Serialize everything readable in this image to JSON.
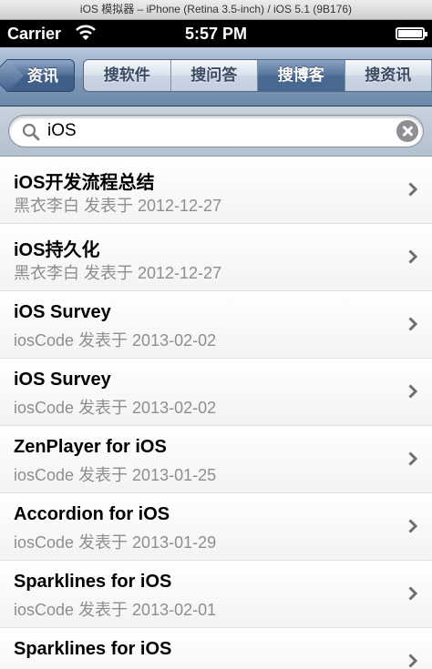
{
  "window_title": "iOS 模拟器 – iPhone (Retina 3.5-inch) / iOS 5.1 (9B176)",
  "status_bar": {
    "carrier": "Carrier",
    "time": "5:57 PM",
    "battery_level": 1.0
  },
  "nav": {
    "back_label": "资讯",
    "segments": [
      {
        "label": "搜软件",
        "selected": false
      },
      {
        "label": "搜问答",
        "selected": false
      },
      {
        "label": "搜博客",
        "selected": true
      },
      {
        "label": "搜资讯",
        "selected": false
      }
    ]
  },
  "search": {
    "value": "iOS",
    "placeholder": ""
  },
  "results": [
    {
      "title": "iOS开发流程总结",
      "subtitle": "黑衣李白 发表于 2012-12-27"
    },
    {
      "title": "iOS持久化",
      "subtitle": "黑衣李白 发表于 2012-12-27"
    },
    {
      "title": "iOS Survey",
      "subtitle": "iosCode 发表于 2013-02-02"
    },
    {
      "title": "iOS Survey",
      "subtitle": "iosCode 发表于 2013-02-02"
    },
    {
      "title": "ZenPlayer for iOS",
      "subtitle": "iosCode 发表于 2013-01-25"
    },
    {
      "title": "Accordion for iOS",
      "subtitle": "iosCode 发表于 2013-01-29"
    },
    {
      "title": "Sparklines for iOS",
      "subtitle": "iosCode 发表于 2013-02-01"
    },
    {
      "title": "Sparklines for iOS",
      "subtitle": ""
    }
  ],
  "icons": {
    "search": "search-icon",
    "clear": "clear-icon",
    "chevron": "chevron-right-icon",
    "wifi": "wifi-icon",
    "battery": "battery-icon"
  }
}
